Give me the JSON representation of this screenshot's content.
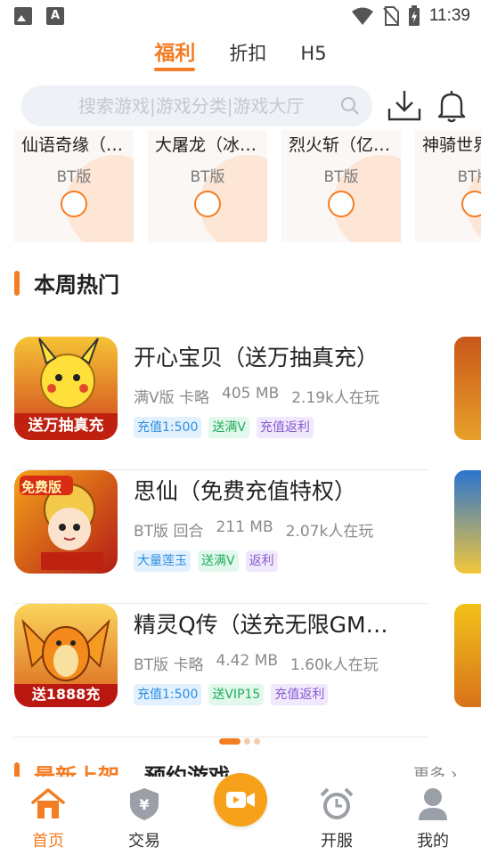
{
  "status_bar": {
    "time": "11:39",
    "left_icons": [
      "image-icon",
      "font-a-icon"
    ],
    "right_icons": [
      "wifi-icon",
      "no-sim-icon",
      "battery-charging-icon"
    ]
  },
  "top_tabs": [
    {
      "label": "福利",
      "active": true
    },
    {
      "label": "折扣",
      "active": false
    },
    {
      "label": "H5",
      "active": false
    }
  ],
  "search": {
    "placeholder": "搜索游戏|游戏分类|游戏大厅"
  },
  "bt_cards": [
    {
      "name": "仙语奇缘（…",
      "version": "BT版"
    },
    {
      "name": "大屠龙（冰…",
      "version": "BT版"
    },
    {
      "name": "烈火斩（亿…",
      "version": "BT版"
    },
    {
      "name": "神骑世界",
      "version": "BT版"
    }
  ],
  "hot_section": {
    "title": "本周热门"
  },
  "games": [
    {
      "title": "开心宝贝（送万抽真充）",
      "icon_banner": "送万抽真充",
      "meta": [
        "满V版 卡略",
        "405 MB",
        "2.19k人在玩"
      ],
      "tags": [
        {
          "label": "充值1:500",
          "style": "blue"
        },
        {
          "label": "送满V",
          "style": "green"
        },
        {
          "label": "充值返利",
          "style": "purple"
        }
      ]
    },
    {
      "title": "思仙（免费充值特权）",
      "icon_banner": "免费版",
      "meta": [
        "BT版 回合",
        "211 MB",
        "2.07k人在玩"
      ],
      "tags": [
        {
          "label": "大量莲玉",
          "style": "blue"
        },
        {
          "label": "送满V",
          "style": "green"
        },
        {
          "label": "返利",
          "style": "purple"
        }
      ]
    },
    {
      "title": "精灵Q传（送充无限GM…",
      "icon_banner": "送1888充",
      "meta": [
        "BT版 卡略",
        "4.42 MB",
        "1.60k人在玩"
      ],
      "tags": [
        {
          "label": "充值1:500",
          "style": "blue"
        },
        {
          "label": "送VIP15",
          "style": "green"
        },
        {
          "label": "充值返利",
          "style": "purple"
        }
      ]
    }
  ],
  "latest_section": {
    "tab1": "最新上架",
    "tab2": "预约游戏",
    "more": "更多"
  },
  "bottom_nav": [
    {
      "label": "首页",
      "icon": "home-icon",
      "active": true
    },
    {
      "label": "交易",
      "icon": "shield-yen-icon",
      "active": false
    },
    {
      "label": "",
      "icon": "video-camera-icon",
      "active": false
    },
    {
      "label": "开服",
      "icon": "alarm-clock-icon",
      "active": false
    },
    {
      "label": "我的",
      "icon": "person-icon",
      "active": false
    }
  ],
  "colors": {
    "accent": "#f47d23",
    "center_button": "#f7a11a",
    "tag_blue": "#2b8de0",
    "tag_green": "#1fae5c",
    "tag_purple": "#8a5ad4"
  }
}
